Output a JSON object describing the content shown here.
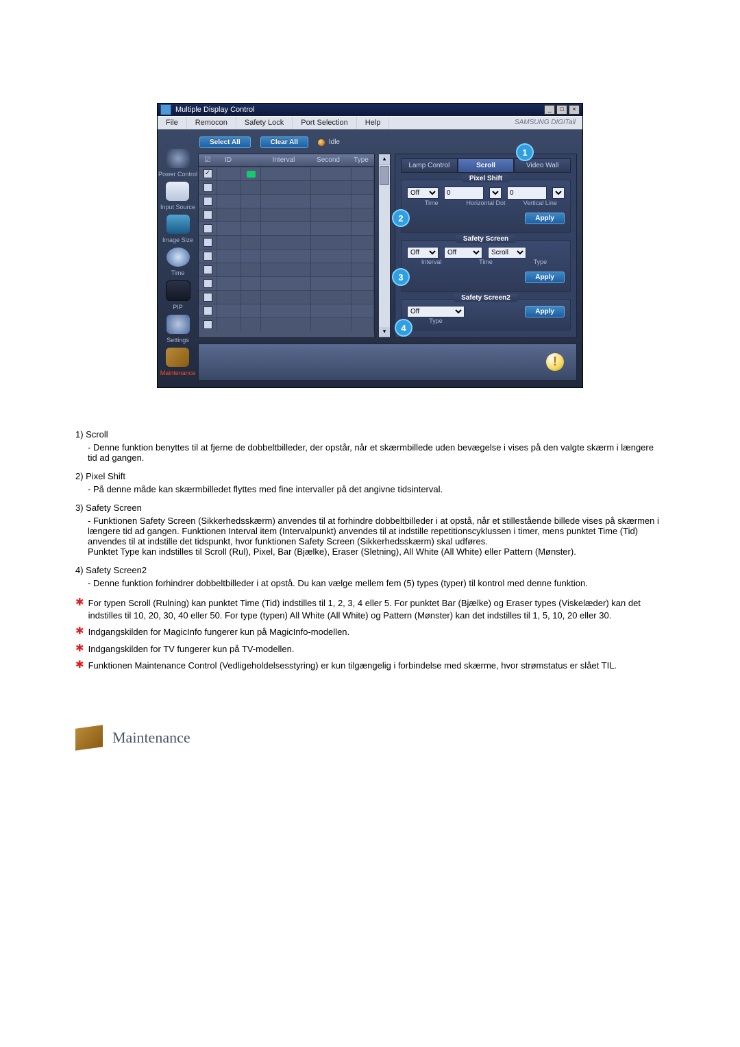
{
  "window": {
    "title": "Multiple Display Control",
    "menus": [
      "File",
      "Remocon",
      "Safety Lock",
      "Port Selection",
      "Help"
    ],
    "brand": "SAMSUNG DIGITall"
  },
  "sidebar": {
    "items": [
      {
        "label": "Power Control"
      },
      {
        "label": "Input Source"
      },
      {
        "label": "Image Size"
      },
      {
        "label": "Time"
      },
      {
        "label": "PIP"
      },
      {
        "label": "Settings"
      },
      {
        "label": "Maintenance",
        "active": true
      }
    ]
  },
  "toolbar": {
    "select_all": "Select All",
    "clear_all": "Clear All",
    "idle": "Idle"
  },
  "grid": {
    "headers": {
      "chk": "☑",
      "id": "ID",
      "status": "",
      "interval": "Interval",
      "second": "Second",
      "type": "Type"
    },
    "rows": 12,
    "first_checked": true
  },
  "tabs": {
    "t1": "Lamp Control",
    "t2": "Scroll",
    "t3": "Video Wall"
  },
  "pixel_shift": {
    "title": "Pixel Shift",
    "time_val": "Off",
    "hd_val": "0",
    "vl_val": "0",
    "time": "Time",
    "hd": "Horizontal Dot",
    "vl": "Vertical Line",
    "apply": "Apply"
  },
  "safety_screen": {
    "title": "Safety Screen",
    "interval_val": "Off",
    "time_val": "Off",
    "type_val": "Scroll",
    "interval": "Interval",
    "time": "Time",
    "type": "Type",
    "apply": "Apply"
  },
  "safety_screen2": {
    "title": "Safety Screen2",
    "type_val": "Off",
    "type": "Type",
    "apply": "Apply"
  },
  "callouts": {
    "c1": "1",
    "c2": "2",
    "c3": "3",
    "c4": "4"
  },
  "desc": {
    "items": [
      {
        "num": "1)",
        "title": "Scroll",
        "body": "- Denne funktion benyttes til at fjerne de dobbeltbilleder, der opstår, når et skærmbillede uden bevægelse i vises på den valgte skærm i længere tid ad gangen."
      },
      {
        "num": "2)",
        "title": "Pixel Shift",
        "body": "- På denne måde kan skærmbilledet flyttes med fine intervaller på det angivne tidsinterval."
      },
      {
        "num": "3)",
        "title": "Safety Screen",
        "body": "- Funktionen Safety Screen (Sikkerhedsskærm) anvendes til at forhindre dobbeltbilleder i at opstå, når et stillestående billede vises på skærmen i længere tid ad gangen.  Funktionen Interval item (Intervalpunkt) anvendes til at indstille repetitionscyklussen i timer, mens punktet Time (Tid) anvendes til at indstille det tidspunkt, hvor funktionen Safety Screen (Sikkerhedsskærm) skal udføres.\nPunktet Type kan indstilles til Scroll (Rul), Pixel, Bar (Bjælke), Eraser (Sletning), All White (All White) eller Pattern (Mønster)."
      },
      {
        "num": "4)",
        "title": "Safety Screen2",
        "body": "- Denne funktion forhindrer dobbeltbilleder i at opstå. Du kan vælge mellem fem (5) types (typer) til kontrol med denne funktion."
      }
    ],
    "notes": [
      "For typen Scroll (Rulning) kan punktet Time (Tid) indstilles til 1, 2, 3, 4 eller 5. For punktet Bar (Bjælke) og Eraser types (Viskelæder) kan det indstilles til 10, 20, 30, 40 eller 50. For type (typen) All White (All White) og Pattern (Mønster) kan det indstilles til 1, 5, 10, 20 eller 30.",
      "Indgangskilden for MagicInfo fungerer kun på MagicInfo-modellen.",
      "Indgangskilden for TV fungerer kun på TV-modellen.",
      "Funktionen Maintenance Control (Vedligeholdelsesstyring) er kun tilgængelig i forbindelse med skærme, hvor strømstatus er slået TIL."
    ]
  },
  "heading": "Maintenance"
}
